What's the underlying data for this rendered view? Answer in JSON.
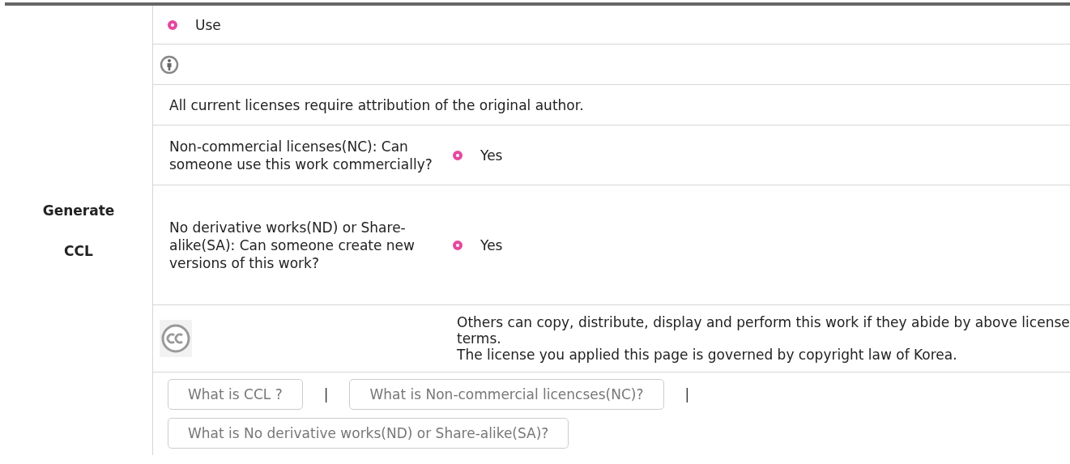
{
  "section_label": [
    "Generate",
    "CCL"
  ],
  "use_option": {
    "label": "Use",
    "selected": true
  },
  "attribution_note": "All current licenses require attribution of the original author.",
  "questions": [
    {
      "question": "Non-commercial licenses(NC): Can someone use this work commercially?",
      "option": {
        "label": "Yes",
        "selected": true
      }
    },
    {
      "question": "No derivative works(ND) or Share-alike(SA): Can someone create new versions of this work?",
      "option": {
        "label": "Yes",
        "selected": true
      }
    }
  ],
  "license_description": [
    "Others can copy, distribute, display and perform this work if they abide by above license terms.",
    "The license you applied this page is governed by copyright law of Korea."
  ],
  "help_buttons": [
    "What is CCL ?",
    "What is Non-commercial licencses(NC)?",
    "What is No derivative works(ND) or Share-alike(SA)?"
  ],
  "separator": "|"
}
